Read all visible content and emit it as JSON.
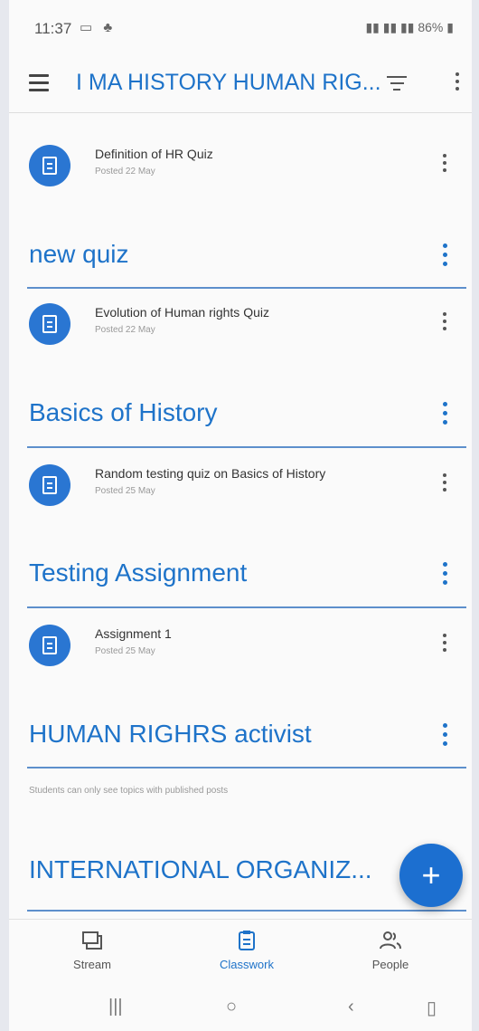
{
  "status": {
    "time": "11:37",
    "battery": "86%"
  },
  "app_bar": {
    "title": "I MA HISTORY HUMAN RIG..."
  },
  "items": [
    {
      "kind": "assignment",
      "title": "Definition of HR Quiz",
      "date": "Posted 22 May"
    },
    {
      "kind": "topic",
      "title": "new quiz"
    },
    {
      "kind": "assignment",
      "title": "Evolution of Human rights Quiz",
      "date": "Posted 22 May"
    },
    {
      "kind": "topic",
      "title": "Basics of History"
    },
    {
      "kind": "assignment",
      "title": "Random testing quiz on Basics of History",
      "date": "Posted 25 May"
    },
    {
      "kind": "topic",
      "title": "Testing Assignment"
    },
    {
      "kind": "assignment",
      "title": "Assignment 1",
      "date": "Posted 25 May"
    },
    {
      "kind": "topic",
      "title": "HUMAN RIGHRS activist"
    },
    {
      "kind": "note",
      "text": "Students can only see topics with published posts"
    },
    {
      "kind": "topic",
      "title": "INTERNATIONAL ORGANIZ..."
    }
  ],
  "bottom_nav": {
    "stream": "Stream",
    "classwork": "Classwork",
    "people": "People"
  },
  "colors": {
    "accent": "#1e73c9",
    "fab": "#1c6fd0"
  }
}
